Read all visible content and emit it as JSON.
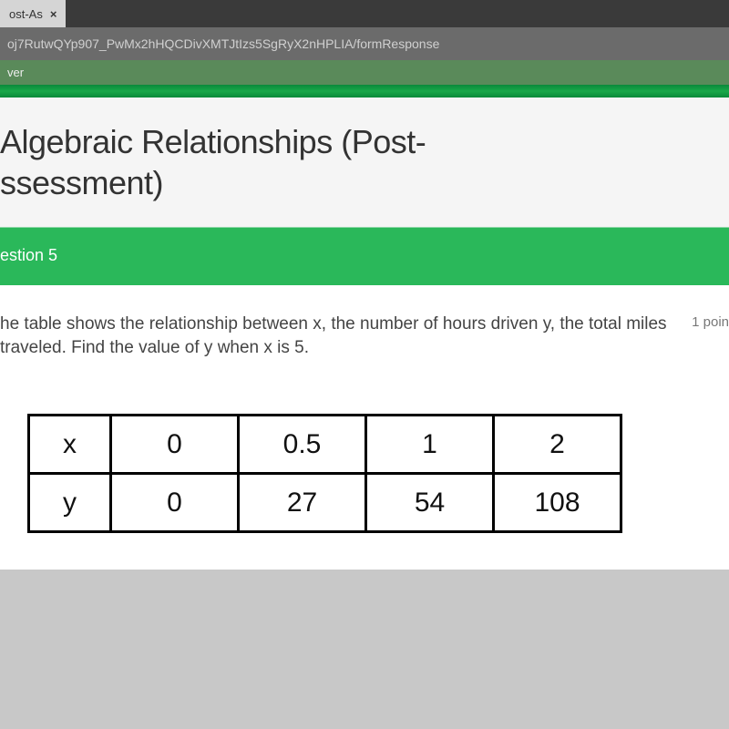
{
  "browser": {
    "tab_label": "ost-As",
    "url_fragment": "oj7RutwQYp907_PwMx2hHQCDivXMTJtIzs5SgRyX2nHPLIA/formResponse",
    "toolbar_label": "ver"
  },
  "form": {
    "title_line1": "Algebraic Relationships (Post-",
    "title_line2": "ssessment)"
  },
  "question": {
    "label": "estion 5",
    "text": "he table shows the relationship between x, the number of hours driven y, the total miles traveled. Find the value of y when x is 5.",
    "points": "1 poin"
  },
  "chart_data": {
    "type": "table",
    "rows": [
      {
        "header": "x",
        "cells": [
          "0",
          "0.5",
          "1",
          "2"
        ]
      },
      {
        "header": "y",
        "cells": [
          "0",
          "27",
          "54",
          "108"
        ]
      }
    ]
  }
}
